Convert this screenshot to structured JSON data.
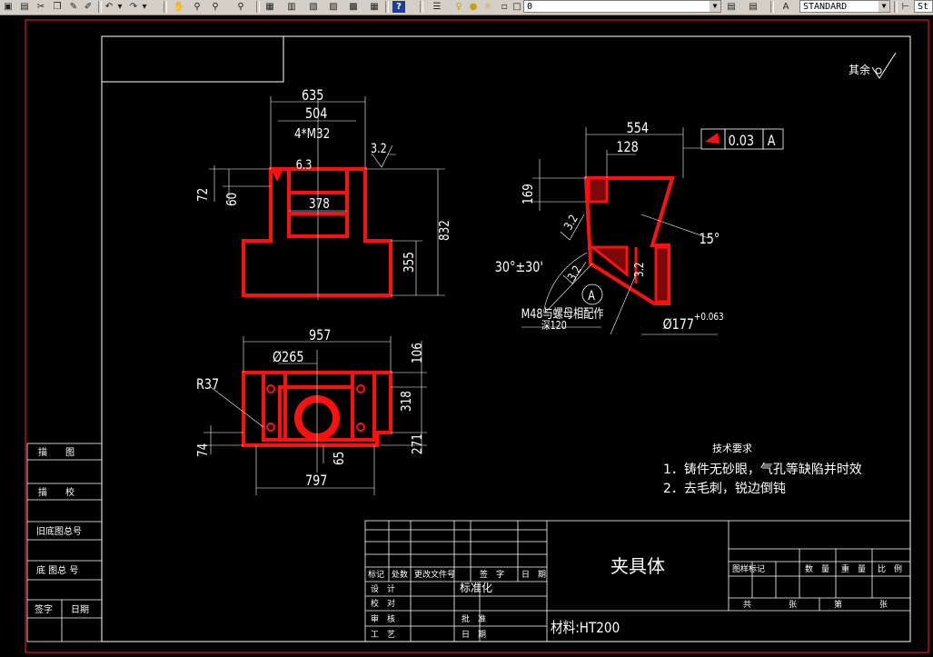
{
  "toolbar": {
    "icons": [
      "open-icon",
      "save-icon",
      "cut-icon",
      "copy-icon",
      "paste-icon",
      "undo-icon",
      "redo-icon",
      "pan-icon",
      "zoom-realtime-icon",
      "zoom-window-icon",
      "zoom-previous-icon",
      "properties-icon",
      "design-center-icon",
      "tool-palettes-icon",
      "markup-icon",
      "calculator-icon",
      "help-icon",
      "layer-manager-icon",
      "layer-state-icon",
      "layer-previous-icon"
    ],
    "layer_value": "0",
    "text_style_value": "STANDARD",
    "dim_style_value": "St"
  },
  "drawing": {
    "roughness_note": "其余",
    "technical_requirements": {
      "title": "技术要求",
      "line1": "1．铸件无砂眼，气孔等缺陷并时效",
      "line2": "2．去毛刺，锐边倒钝"
    },
    "left_sidebar": {
      "row1": "描　　图",
      "row2": "描　　校",
      "row3": "旧底图总号",
      "row4": "底 图总 号",
      "row5_a": "签字",
      "row5_b": "日期"
    },
    "title_block": {
      "part_name": "夹具体",
      "material": "材料:HT200",
      "col_mark": "标记",
      "col_count": "处数",
      "col_doc": "更改文件号",
      "col_sign": "签　字",
      "col_date": "日　期",
      "design": "设　计",
      "standard": "标准化",
      "check": "校　对",
      "review": "审　核",
      "approve": "批　准",
      "process": "工　艺",
      "date2": "日　期",
      "stage": "图样标记",
      "qty": "数　量",
      "weight": "重　量",
      "scale": "比　例",
      "total": "共",
      "sheets": "张",
      "sheet_no": "第",
      "sheets2": "张"
    },
    "dims_front": {
      "d635": "635",
      "d504": "504",
      "thread": "4*M32",
      "d63": "6.3",
      "d32": "3.2",
      "d72": "72",
      "d60": "60",
      "d378": "378",
      "d832": "832",
      "d355": "355"
    },
    "dims_top": {
      "d957": "957",
      "d265": "Ø265",
      "r37": "R37",
      "d106": "106",
      "d318": "318",
      "d74": "74",
      "d65": "65",
      "d271": "271",
      "d797": "797"
    },
    "dims_side": {
      "d554": "554",
      "d128": "128",
      "d169": "169",
      "d32a": "3.2",
      "d32b": "3.2",
      "d32c": "3.2",
      "angle15": "15°",
      "angle30": "30°±30'",
      "tol_value": "0.03",
      "tol_datum": "A",
      "datum_label": "A",
      "thread_note": "M48与螺母相配作",
      "depth": "深120",
      "bore": "Ø177",
      "bore_tol": "+0.063"
    }
  }
}
